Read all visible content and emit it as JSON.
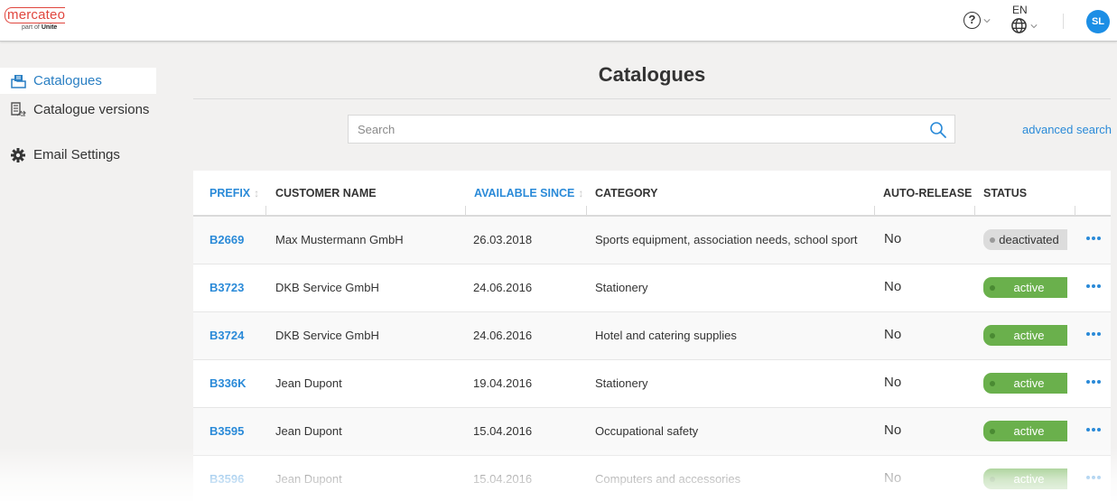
{
  "header": {
    "logo_text": "mercateo",
    "logo_sub_prefix": "part of",
    "logo_sub_brand": "Unite",
    "help_label": "?",
    "language": "EN",
    "avatar_initials": "SL",
    "accent_color": "#1c8ee5"
  },
  "sidebar": {
    "items": [
      {
        "label": "Catalogues",
        "icon": "catalogue-icon",
        "active": true
      },
      {
        "label": "Catalogue versions",
        "icon": "catalogue-versions-icon",
        "active": false
      },
      {
        "label": "Email Settings",
        "icon": "gear-icon",
        "active": false
      }
    ]
  },
  "main": {
    "title": "Catalogues",
    "search": {
      "placeholder": "Search",
      "value": ""
    },
    "advanced_search_label": "advanced search",
    "table": {
      "columns": [
        {
          "label": "PREFIX",
          "sortable": true
        },
        {
          "label": "CUSTOMER NAME",
          "sortable": false
        },
        {
          "label": "AVAILABLE SINCE",
          "sortable": true
        },
        {
          "label": "CATEGORY",
          "sortable": false
        },
        {
          "label": "AUTO-RELEASE",
          "sortable": false
        },
        {
          "label": "STATUS",
          "sortable": false
        }
      ],
      "rows": [
        {
          "prefix": "B2669",
          "customer": "Max Mustermann GmbH",
          "since": "26.03.2018",
          "category": "Sports equipment, association needs, school sport",
          "auto_release": "No",
          "status": "deactivated"
        },
        {
          "prefix": "B3723",
          "customer": "DKB Service GmbH",
          "since": "24.06.2016",
          "category": "Stationery",
          "auto_release": "No",
          "status": "active"
        },
        {
          "prefix": "B3724",
          "customer": "DKB Service GmbH",
          "since": "24.06.2016",
          "category": "Hotel and catering supplies",
          "auto_release": "No",
          "status": "active"
        },
        {
          "prefix": "B336K",
          "customer": "Jean Dupont",
          "since": "19.04.2016",
          "category": "Stationery",
          "auto_release": "No",
          "status": "active"
        },
        {
          "prefix": "B3595",
          "customer": "Jean Dupont",
          "since": "15.04.2016",
          "category": "Occupational safety",
          "auto_release": "No",
          "status": "active"
        },
        {
          "prefix": "B3596",
          "customer": "Jean Dupont",
          "since": "15.04.2016",
          "category": "Computers and accessories",
          "auto_release": "No",
          "status": "active"
        }
      ]
    },
    "status_colors": {
      "active": "#6ab04c",
      "deactivated": "#dcdcdc"
    },
    "link_color": "#2a8ad8"
  }
}
